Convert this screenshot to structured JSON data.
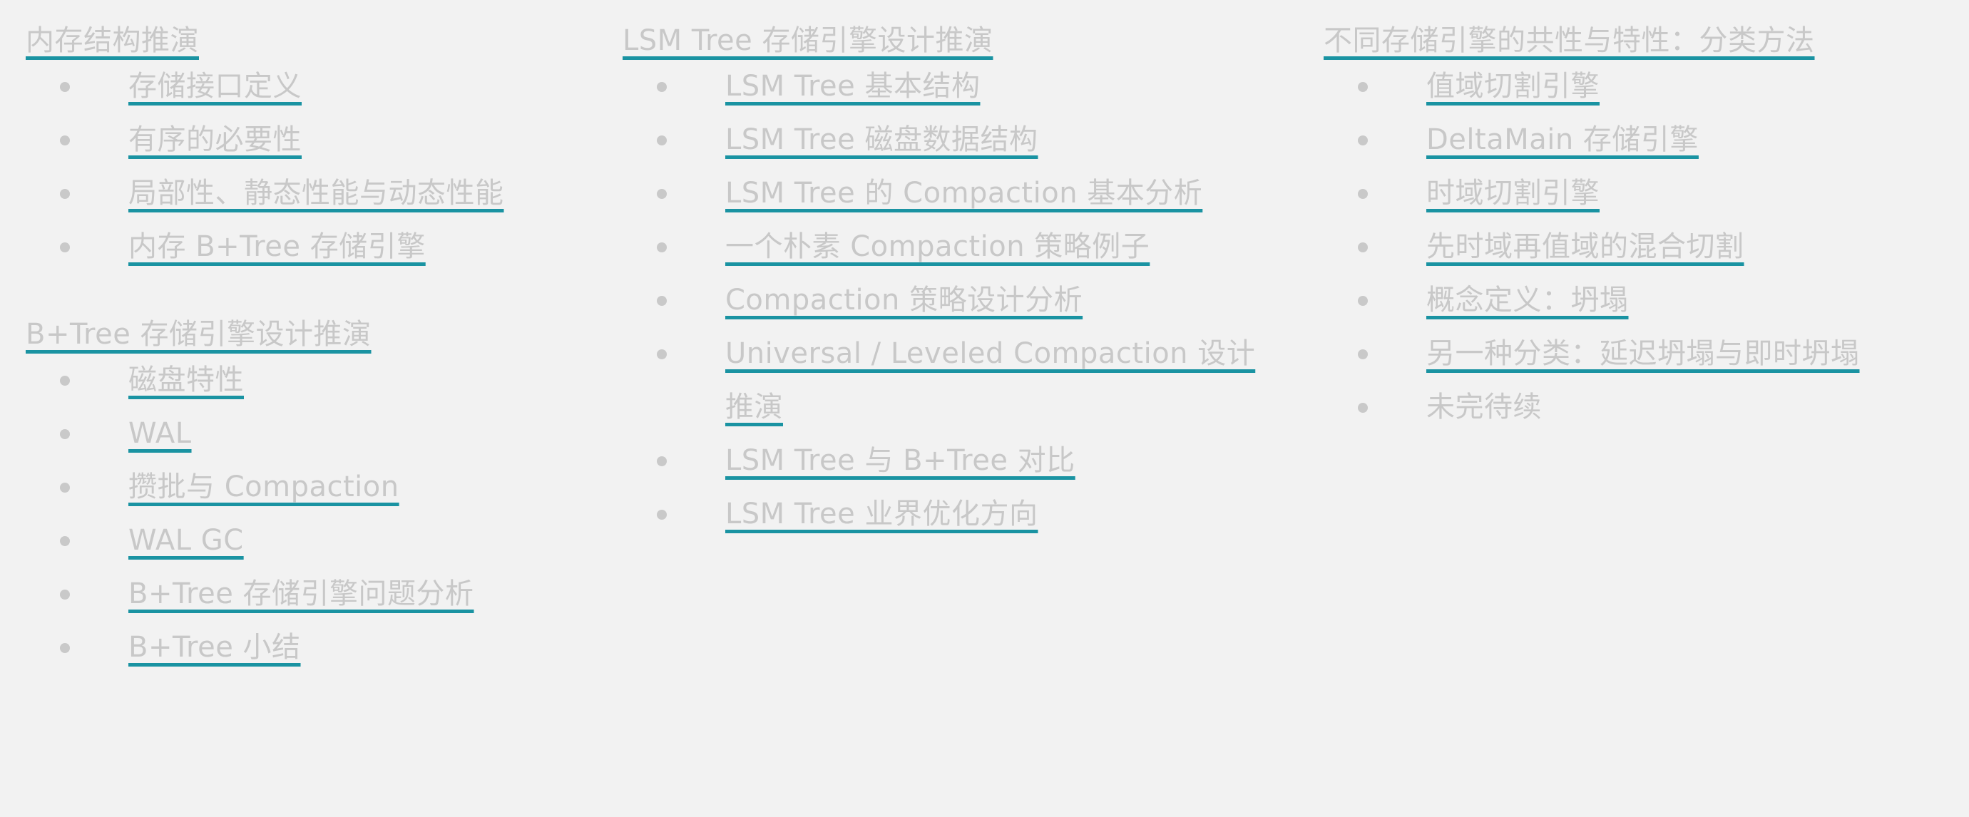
{
  "columns": [
    {
      "sections": [
        {
          "title": "内存结构推演",
          "items": [
            "存储接口定义",
            "有序的必要性",
            "局部性、静态性能与动态性能",
            "内存 B+Tree 存储引擎"
          ]
        },
        {
          "title": "B+Tree 存储引擎设计推演",
          "items": [
            "磁盘特性",
            "WAL",
            "攒批与 Compaction",
            "WAL GC",
            "B+Tree 存储引擎问题分析",
            "B+Tree 小结"
          ]
        }
      ]
    },
    {
      "sections": [
        {
          "title": "LSM Tree 存储引擎设计推演",
          "items": [
            "LSM Tree 基本结构",
            "LSM Tree 磁盘数据结构",
            "LSM Tree 的 Compaction 基本分析",
            "一个朴素 Compaction 策略例子",
            "Compaction 策略设计分析",
            "Universal / Leveled Compaction 设计推演",
            "LSM Tree 与 B+Tree 对比",
            "LSM Tree 业界优化方向"
          ]
        }
      ]
    },
    {
      "sections": [
        {
          "title": "不同存储引擎的共性与特性：分类方法",
          "items": [
            "值域切割引擎",
            "DeltaMain 存储引擎",
            "时域切割引擎",
            "先时域再值域的混合切割",
            "概念定义：坍塌",
            "另一种分类：延迟坍塌与即时坍塌"
          ],
          "pending": "未完待续"
        }
      ]
    }
  ]
}
